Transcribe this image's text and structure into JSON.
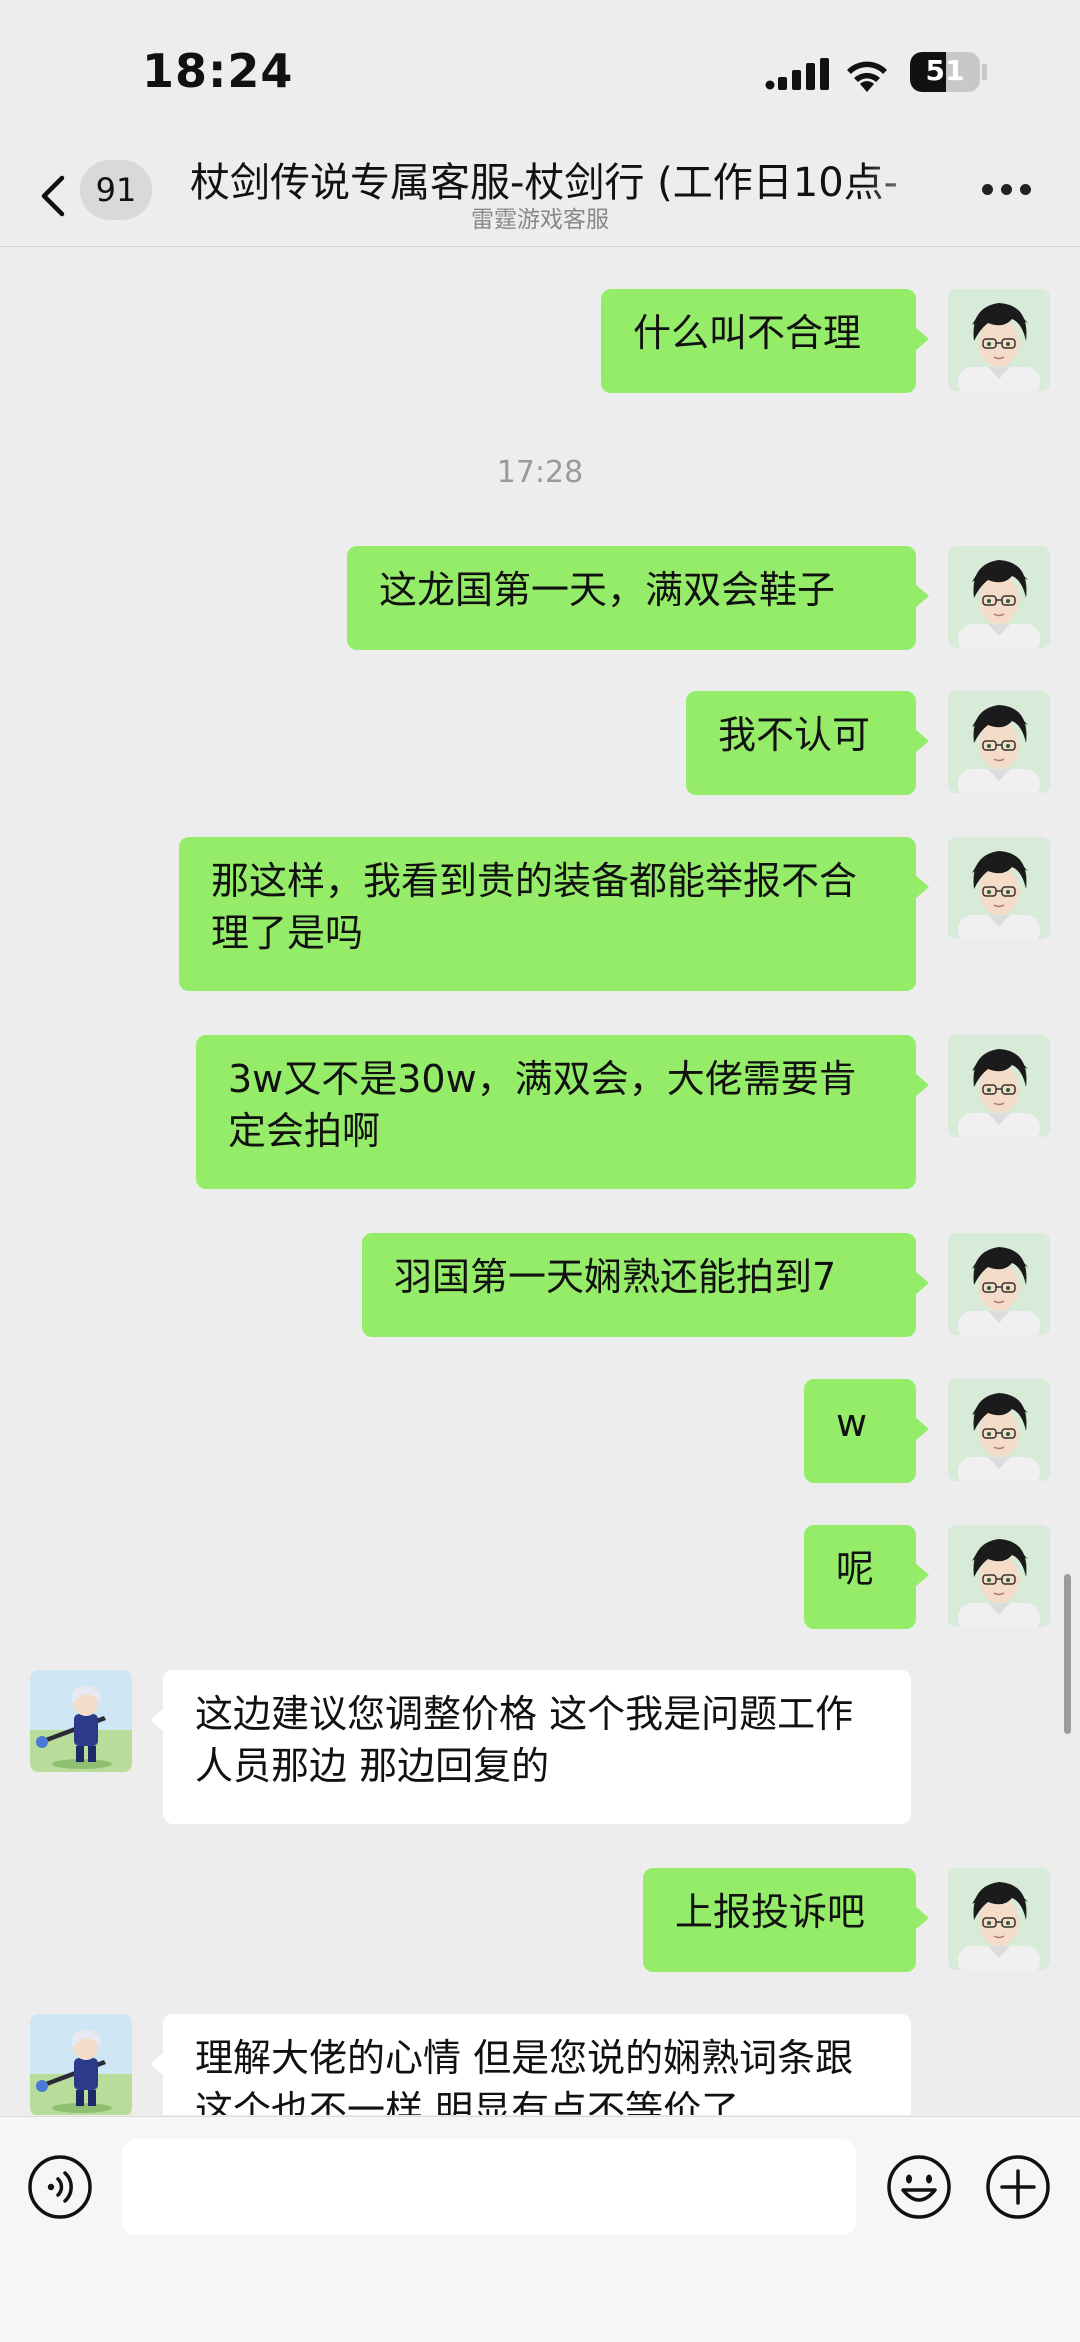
{
  "status_bar": {
    "time": "18:24",
    "battery": "51",
    "battery_level": 0.51
  },
  "nav": {
    "back_icon": "chevron-left-icon",
    "unread_badge": "91",
    "title": "杖剑传说专属客服-杖剑行 (工作日10点-",
    "subtitle": "雷霆游戏客服",
    "more_icon": "more-dots-icon"
  },
  "messages": [
    {
      "sender": "me",
      "text": "什么叫不合理"
    },
    {
      "type": "timestamp",
      "text": "17:28"
    },
    {
      "sender": "me",
      "text": "这龙国第一天，满双会鞋子"
    },
    {
      "sender": "me",
      "text": "我不认可"
    },
    {
      "sender": "me",
      "text": "那这样，我看到贵的装备都能举报不合理了是吗"
    },
    {
      "sender": "me",
      "text": "3w又不是30w，满双会，大佬需要肯定会拍啊"
    },
    {
      "sender": "me",
      "text": "羽国第一天娴熟还能拍到7"
    },
    {
      "sender": "me",
      "text": "w"
    },
    {
      "sender": "me",
      "text": "呢"
    },
    {
      "sender": "other",
      "text": "这边建议您调整价格 这个我是问题工作人员那边 那边回复的"
    },
    {
      "sender": "me",
      "text": "上报投诉吧"
    },
    {
      "sender": "other",
      "text": "理解大佬的心情  但是您说的娴熟词条跟这个也不一样 明显有点不等价了"
    }
  ],
  "input_bar": {
    "voice_icon": "voice-icon",
    "emoji_icon": "emoji-icon",
    "plus_icon": "plus-icon",
    "input_value": ""
  },
  "colors": {
    "my_bubble": "#95ec69",
    "other_bubble": "#ffffff",
    "background": "#ededed"
  }
}
